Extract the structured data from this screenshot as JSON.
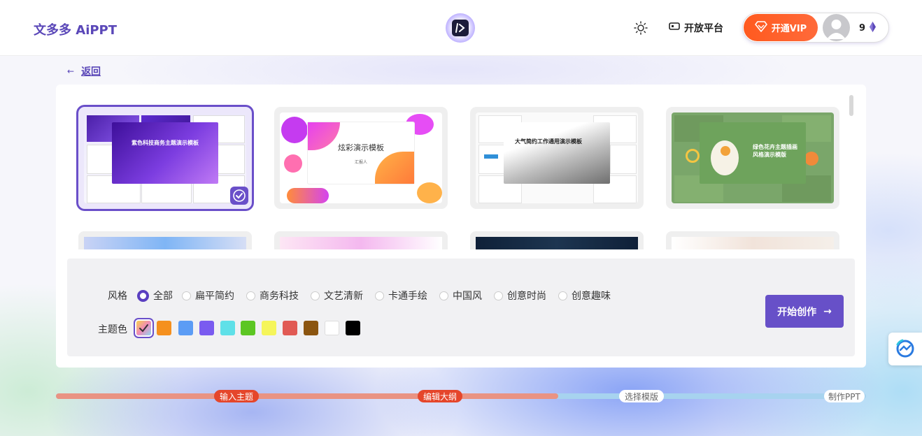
{
  "header": {
    "brand": "文多多 AiPPT",
    "open_platform_label": "开放平台",
    "vip_label": "开通VIP",
    "credits": "9"
  },
  "nav": {
    "back_label": "返回"
  },
  "templates": [
    {
      "title": "紫色科技商务主题演示模板",
      "selected": true
    },
    {
      "title": "炫彩演示模板",
      "subtitle": "汇报人"
    },
    {
      "title": "大气简约工作通用演示模板"
    },
    {
      "title": "绿色花卉主题插画风格演示模版"
    }
  ],
  "filters": {
    "style_label": "风格",
    "style_options": [
      "全部",
      "扁平简约",
      "商务科技",
      "文艺清新",
      "卡通手绘",
      "中国风",
      "创意时尚",
      "创意趣味"
    ],
    "style_selected": "全部",
    "color_label": "主题色",
    "colors": [
      "#f0c050",
      "#f5901e",
      "#5b9cf5",
      "#7a5bf0",
      "#5fe0e8",
      "#5cc623",
      "#f5f55a",
      "#e15a54",
      "#8b5510",
      "#ffffff",
      "#000000"
    ],
    "color_selected": 0
  },
  "start_button_label": "开始创作",
  "steps": [
    {
      "label": "输入主题",
      "done": true
    },
    {
      "label": "编辑大纲",
      "done": true
    },
    {
      "label": "选择模版",
      "done": false
    },
    {
      "label": "制作PPT",
      "done": false
    }
  ],
  "progress_fraction": 0.62,
  "colors": {
    "accent": "#6750c8",
    "brand": "#5a47b8",
    "vip": "#ff5a1f",
    "step_done": "#e5462b"
  }
}
